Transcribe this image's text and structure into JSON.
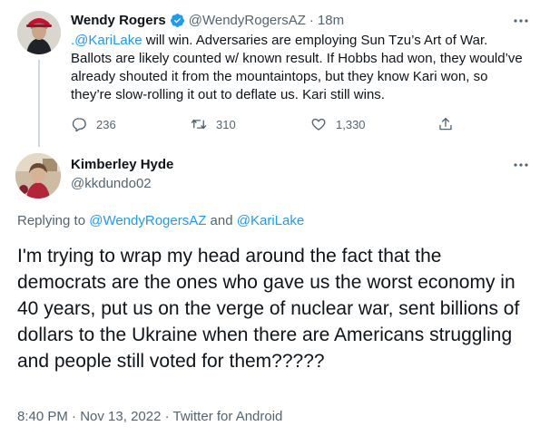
{
  "parent_tweet": {
    "author_name": "Wendy Rogers",
    "author_handle": "@WendyRogersAZ",
    "separator": "·",
    "time": "18m",
    "text_mention": ".@KariLake",
    "text_body": " will win. Adversaries are employing Sun Tzu’s Art of War. Ballots are likely counted w/ known result. If Hobbs had won, they would’ve already shouted it from the mountaintops, but they know Kari won, so they’re slow-rolling it out to deflate us. Kari still wins.",
    "stats": {
      "replies": "236",
      "retweets": "310",
      "likes": "1,330"
    },
    "icons": [
      "verified-badge-icon",
      "more-icon",
      "reply-icon",
      "retweet-icon",
      "like-icon",
      "share-icon"
    ]
  },
  "main_tweet": {
    "author_name": "Kimberley Hyde",
    "author_handle": "@kkdundo02",
    "replying_prefix": "Replying to ",
    "replying_user1": "@WendyRogersAZ",
    "replying_and": " and ",
    "replying_user2": "@KariLake",
    "text": "I'm trying to wrap my head around the fact that the democrats are the ones who gave us the worst economy in 40 years, put us on the verge of nuclear war, sent billions of dollars to the Ukraine when there are Americans struggling and people still voted for them?????",
    "time": "8:40 PM",
    "date": "Nov 13, 2022",
    "meta_separator": " · ",
    "source": "Twitter for Android"
  },
  "colors": {
    "text": "#0f1419",
    "secondary": "#536471",
    "link": "#1d9bf0",
    "thread_line": "#cfd9de"
  }
}
